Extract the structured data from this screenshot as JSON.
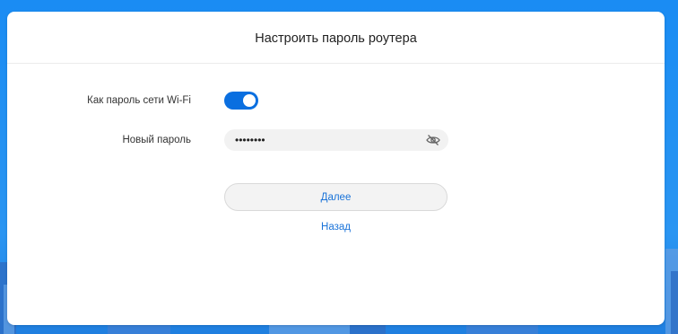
{
  "dialog": {
    "title": "Настроить пароль роутера",
    "wifi_toggle": {
      "label": "Как пароль сети Wi-Fi",
      "state": "on"
    },
    "new_password": {
      "label": "Новый пароль",
      "value": "••••••••"
    },
    "next_button": "Далее",
    "back_link": "Назад"
  },
  "colors": {
    "accent": "#0a6fe0",
    "link": "#1a73d9",
    "background": "#1f8df0"
  },
  "icons": {
    "password_visibility": "eye-off-icon"
  }
}
